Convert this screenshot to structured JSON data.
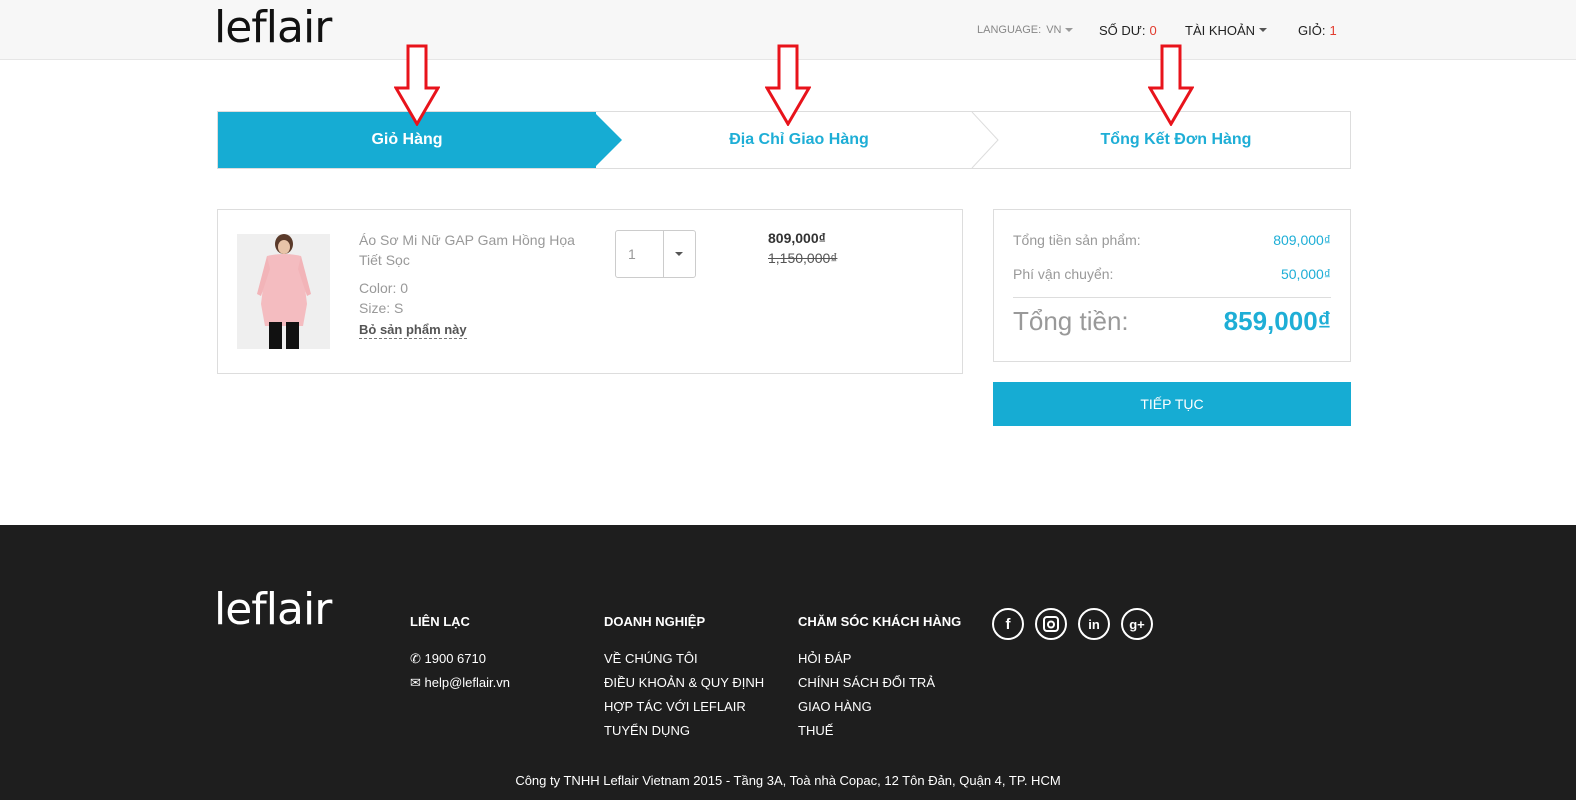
{
  "header": {
    "logo": "leflair",
    "language_label": "LANGUAGE:",
    "language_value": "VN",
    "balance_label": "SỐ DƯ:",
    "balance_value": "0",
    "account_label": "TÀI KHOẢN",
    "cart_label": "GIỎ:",
    "cart_count": "1"
  },
  "steps": [
    {
      "label": "Giỏ Hàng",
      "active": true
    },
    {
      "label": "Địa Chỉ Giao Hàng",
      "active": false
    },
    {
      "label": "Tổng Kết Đơn Hàng",
      "active": false
    }
  ],
  "cart_item": {
    "name": "Áo Sơ Mi Nữ GAP Gam Hồng Họa Tiết Sọc",
    "color": "Color: 0",
    "size": "Size: S",
    "remove_label": "Bỏ sản phẩm này",
    "quantity": "1",
    "price": "809,000₫",
    "old_price": "1,150,000₫"
  },
  "summary": {
    "subtotal_label": "Tổng tiền sản phẩm:",
    "subtotal_value": "809,000₫",
    "shipping_label": "Phí vận chuyển:",
    "shipping_value": "50,000₫",
    "total_label": "Tổng tiền:",
    "total_value": "859,000₫",
    "continue_label": "TIẾP TỤC"
  },
  "footer": {
    "logo": "leflair",
    "contact": {
      "title": "LIÊN LẠC",
      "phone": "1900 6710",
      "email": "help@leflair.vn"
    },
    "business": {
      "title": "DOANH NGHIỆP",
      "items": [
        "VỀ CHÚNG TÔI",
        "ĐIỀU KHOẢN & QUY ĐỊNH",
        "HỢP TÁC VỚI LEFLAIR",
        "TUYỂN DỤNG"
      ]
    },
    "care": {
      "title": "CHĂM SÓC KHÁCH HÀNG",
      "items": [
        "HỎI ĐÁP",
        "CHÍNH SÁCH ĐỔI TRẢ",
        "GIAO HÀNG",
        "THUẾ"
      ]
    },
    "social": [
      "facebook-icon",
      "instagram-icon",
      "linkedin-icon",
      "google-plus-icon"
    ],
    "copyright": "Công ty TNHH Leflair Vietnam 2015 - Tầng 3A, Toà nhà Copac, 12 Tôn Đản, Quận 4, TP. HCM"
  },
  "colors": {
    "accent": "#16acd3",
    "highlight": "#e23b2e",
    "footer_bg": "#1e1e1e"
  }
}
